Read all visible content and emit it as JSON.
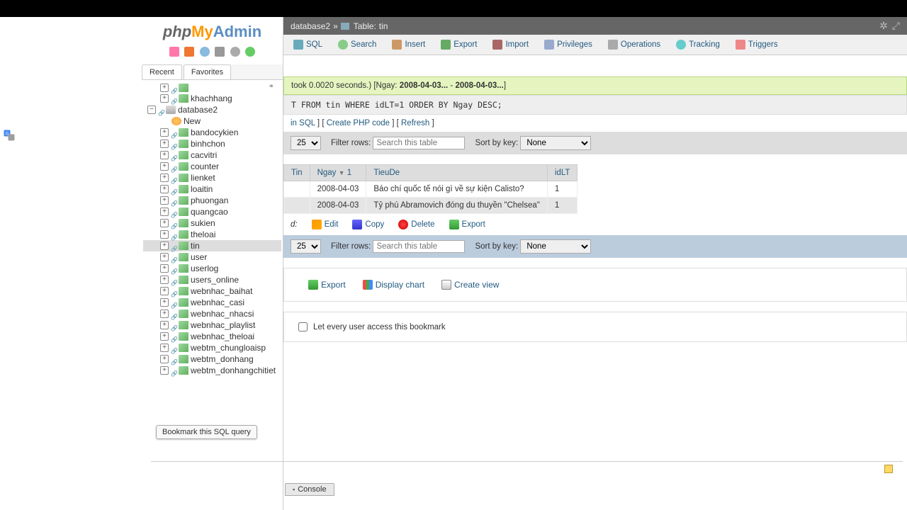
{
  "logo": {
    "php": "php",
    "my": "My",
    "admin": "Admin"
  },
  "sidebar_tabs": {
    "recent": "Recent",
    "favorites": "Favorites"
  },
  "tree": {
    "prev_table": "khachhang",
    "database": "database2",
    "new": "New",
    "selected": "tin",
    "tables": [
      "bandocykien",
      "binhchon",
      "cacvitri",
      "counter",
      "lienket",
      "loaitin",
      "phuongan",
      "quangcao",
      "sukien",
      "theloai",
      "tin",
      "user",
      "userlog",
      "users_online",
      "webnhac_baihat",
      "webnhac_casi",
      "webnhac_nhacsi",
      "webnhac_playlist",
      "webnhac_theloai",
      "webtm_chungloaisp",
      "webtm_donhang",
      "webtm_donhangchitiet"
    ]
  },
  "breadcrumb": {
    "db": "database2",
    "sep": "»",
    "table_label": "Table:",
    "table": "tin"
  },
  "topnav": [
    "SQL",
    "Search",
    "Insert",
    "Export",
    "Import",
    "Privileges",
    "Operations",
    "Tracking",
    "Triggers"
  ],
  "success": {
    "prefix": "took 0.0020 seconds.) [Ngay:",
    "d1": "2008-04-03...",
    "mid": "-",
    "d2": "2008-04-03...",
    "end": "]"
  },
  "sql": "T FROM tin WHERE idLT=1 ORDER BY Ngay DESC;",
  "links": {
    "sql": "in SQL",
    "php": "Create PHP code",
    "refresh": "Refresh"
  },
  "filter": {
    "rows": "25",
    "filter_label": "Filter rows:",
    "placeholder": "Search this table",
    "sort_label": "Sort by key:",
    "sort_sel": "None"
  },
  "table": {
    "headers": {
      "tin": "Tin",
      "ngay": "Ngay",
      "sort_idx": "1",
      "tieude": "TieuDe",
      "idlt": "idLT"
    },
    "rows": [
      {
        "ngay": "2008-04-03",
        "tieude": "Báo chí quốc tế nói gì về sự kiện Calisto?",
        "idlt": "1"
      },
      {
        "ngay": "2008-04-03",
        "tieude": "Tỷ phú Abramovich đóng du thuyền \"Chelsea\"",
        "idlt": "1"
      }
    ]
  },
  "actions": {
    "d": "d:",
    "edit": "Edit",
    "copy": "Copy",
    "delete": "Delete",
    "export": "Export"
  },
  "ops": {
    "export": "Export",
    "chart": "Display chart",
    "view": "Create view"
  },
  "bookmark": {
    "checkbox_label": "Let every user access this bookmark"
  },
  "tooltip": "Bookmark this SQL query",
  "console": "Console"
}
